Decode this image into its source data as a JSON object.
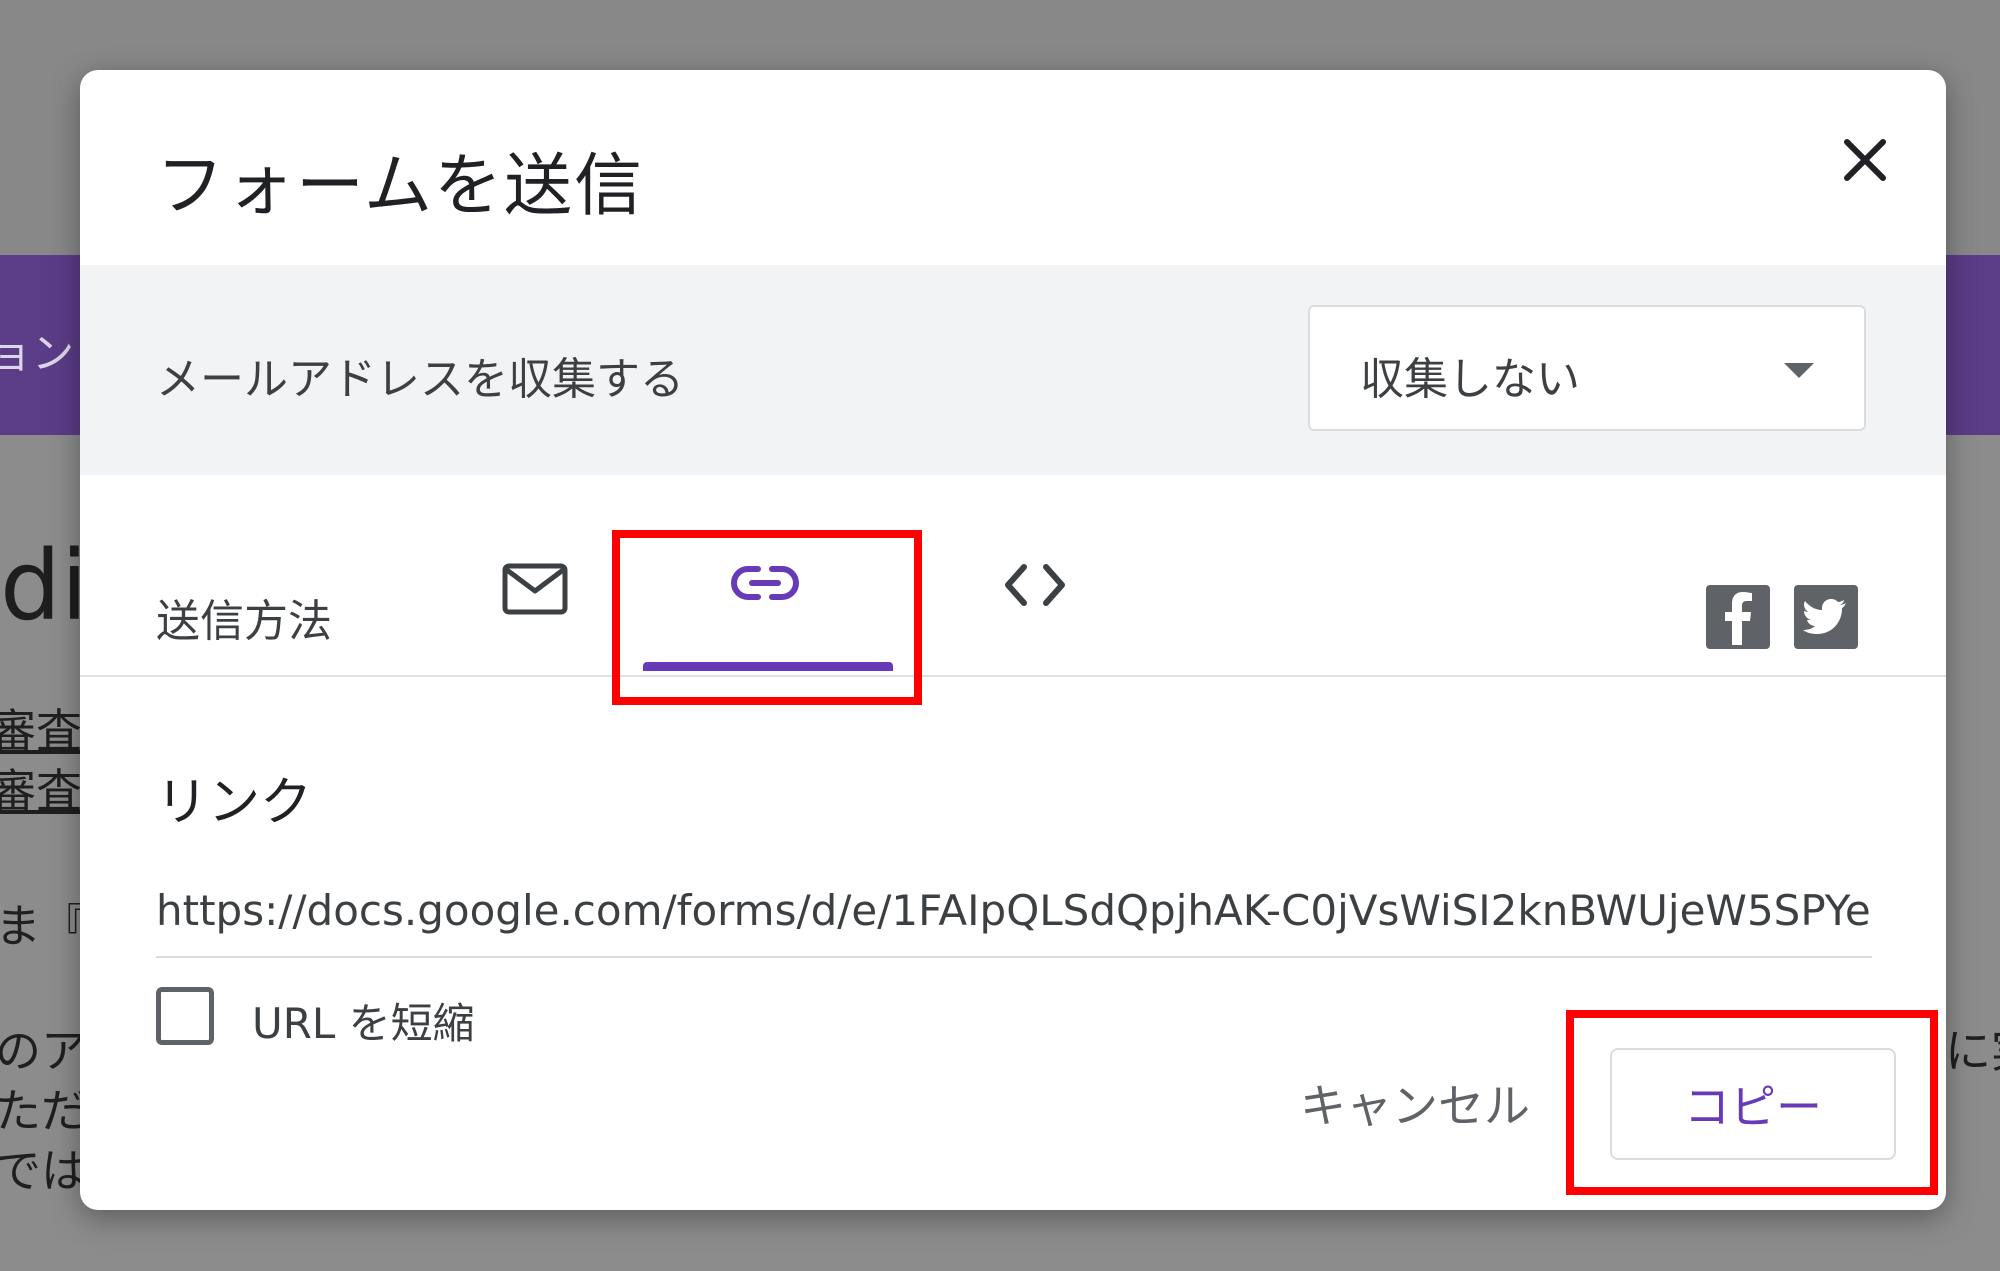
{
  "background": {
    "tab_fragment": "ョン",
    "heading_fragment": "di",
    "link_fragments": [
      "審査",
      "審査"
    ],
    "text_fragments": [
      "ま『",
      "のア",
      "ただ",
      "では"
    ],
    "right_fragment": "に実"
  },
  "dialog": {
    "title": "フォームを送信",
    "close_icon": "close-icon",
    "email_collection": {
      "label": "メールアドレスを収集する",
      "selected": "収集しない"
    },
    "send_via": {
      "label": "送信方法",
      "tabs": [
        {
          "name": "email",
          "icon": "mail-icon"
        },
        {
          "name": "link",
          "icon": "link-icon",
          "active": true
        },
        {
          "name": "embed",
          "icon": "code-icon"
        }
      ],
      "social": [
        "facebook-icon",
        "twitter-icon"
      ]
    },
    "link_section": {
      "heading": "リンク",
      "url": "https://docs.google.com/forms/d/e/1FAIpQLSdQpjhAK-C0jVsWiSI2knBWUjeW5SPYe",
      "shorten_label": "URL を短縮",
      "shorten_checked": false
    },
    "buttons": {
      "cancel": "キャンセル",
      "copy": "コピー"
    }
  },
  "colors": {
    "accent": "#673ab7",
    "highlight": "#ff0000",
    "overlay": "#8c8c8c"
  }
}
